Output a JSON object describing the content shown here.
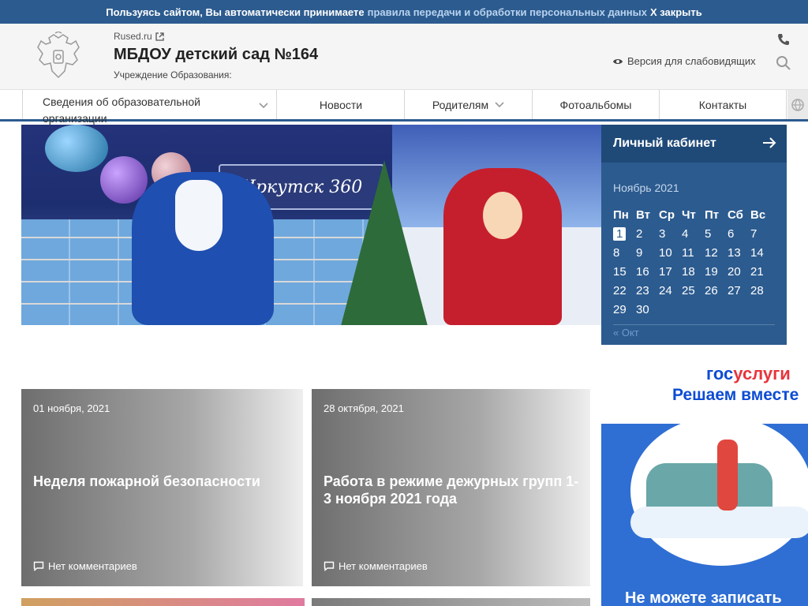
{
  "cookie": {
    "text": "Пользуясь сайтом, Вы автоматически принимаете",
    "link": "правила передачи и обработки персональных данных",
    "close": "Х закрыть"
  },
  "header": {
    "site_link": "Rused.ru",
    "title": "МБДОУ детский сад №164",
    "subtitle": "Учреждение Образования:",
    "vision": "Версия для слабовидящих"
  },
  "nav": {
    "items": [
      {
        "label": "Сведения об образовательной организации"
      },
      {
        "label": "Новости"
      },
      {
        "label": "Родителям"
      },
      {
        "label": "Фотоальбомы"
      },
      {
        "label": "Контакты"
      }
    ]
  },
  "banner": {
    "sign": "Иркутск 360"
  },
  "sidebar": {
    "cabinet": "Личный кабинет",
    "calendar": {
      "month": "Ноябрь 2021",
      "weekdays": [
        "Пн",
        "Вт",
        "Ср",
        "Чт",
        "Пт",
        "Сб",
        "Вс"
      ],
      "prev": "« Окт"
    },
    "gosuslugi": {
      "logo_a": "гос",
      "logo_b": "услуги",
      "slogan": "Решаем вместе",
      "bottom": "Не можете записать"
    }
  },
  "news": [
    {
      "date": "01 ноября, 2021",
      "title": "Неделя пожарной безопасности",
      "comments": "Нет комментариев"
    },
    {
      "date": "28 октября, 2021",
      "title": "Работа в режиме дежурных групп 1-3 ноября 2021 года",
      "comments": "Нет комментариев"
    }
  ],
  "colors": {
    "primary": "#2c5b8f",
    "primary_dark": "#1f4a78",
    "gos_blue": "#0d4cd3",
    "gos_red": "#e8343c"
  }
}
